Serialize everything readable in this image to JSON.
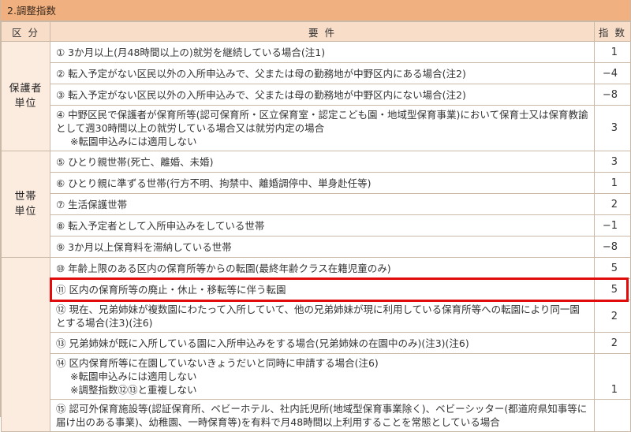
{
  "section_title": "2.調整指数",
  "header": {
    "category": "区 分",
    "requirement": "要 件",
    "index": "指 数"
  },
  "groups": [
    {
      "category": [
        "保護者",
        "単位"
      ],
      "rows": [
        {
          "text": "① 3か月以上(月48時間以上の)就労を継続している場合(注1)",
          "value": "1"
        },
        {
          "text": "② 転入予定がない区民以外の入所申込みで、父または母の勤務地が中野区内にある場合(注2)",
          "value": "−4"
        },
        {
          "text": "③ 転入予定がない区民以外の入所申込みで、父または母の勤務地が中野区内にない場合(注2)",
          "value": "−8"
        },
        {
          "text": "④ 中野区民で保護者が保育所等(認可保育所・区立保育室・認定こども園・地域型保育事業)において保育士又は保育教諭として週30時間以上の就労している場合又は就労内定の場合",
          "note": "※転園申込みには適用しない",
          "value": "3"
        }
      ]
    },
    {
      "category": [
        "世帯",
        "単位"
      ],
      "rows": [
        {
          "text": "⑤ ひとり親世帯(死亡、離婚、未婚)",
          "value": "3"
        },
        {
          "text": "⑥ ひとり親に準ずる世帯(行方不明、拘禁中、離婚調停中、単身赴任等)",
          "value": "1"
        },
        {
          "text": "⑦ 生活保護世帯",
          "value": "2"
        },
        {
          "text": "⑧ 転入予定者として入所申込みをしている世帯",
          "value": "−1"
        },
        {
          "text": "⑨ 3か月以上保育料を滞納している世帯",
          "value": "−8"
        }
      ]
    },
    {
      "category": [
        "",
        ""
      ],
      "rows": [
        {
          "text": "⑩ 年齢上限のある区内の保育所等からの転園(最終年齢クラス在籍児童のみ)",
          "value": "5"
        },
        {
          "text": "⑪ 区内の保育所等の廃止・休止・移転等に伴う転園",
          "value": "5"
        },
        {
          "text": "⑫ 現在、兄弟姉妹が複数園にわたって入所していて、他の兄弟姉妹が現に利用している保育所等への転園により同一園とする場合(注3)(注6)",
          "value": "2"
        },
        {
          "text": "⑬ 兄弟姉妹が既に入所している園に入所申込みをする場合(兄弟姉妹の在園中のみ)(注3)(注6)",
          "value": "2"
        },
        {
          "text": "⑭ 区内保育所等に在園していないきょうだいと同時に申請する場合(注6)",
          "note": "※転園申込みには適用しない",
          "note2": "※調整指数⑫⑬と重複しない",
          "value": "1"
        },
        {
          "text": "⑮ 認可外保育施設等(認証保育所、ベビーホテル、社内託児所(地域型保育事業除く)、ベビーシッター(都道府県知事等に届け出のある事業)、幼稚園、一時保育等)を有料で月48時間以上利用することを常態としている場合",
          "value": ""
        }
      ]
    }
  ],
  "highlight_color": "#e00b0b",
  "header_color": "#f0b07f"
}
